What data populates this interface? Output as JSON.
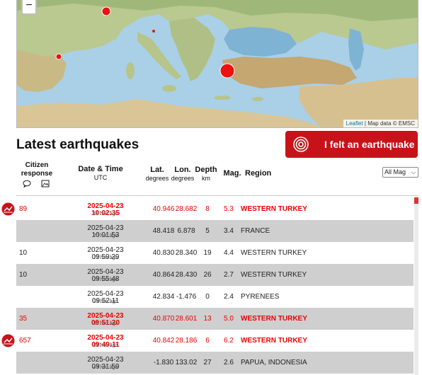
{
  "map": {
    "zoom_out": "−",
    "attribution_link": "Leaflet",
    "attribution_text": "| Map data © EMSC",
    "markers": [
      {
        "region": "WESTERN TURKEY",
        "mag": 5.3,
        "color": "#ee1111"
      },
      {
        "region": "FRANCE",
        "mag": 3.4,
        "color": "#ee1111"
      },
      {
        "region": "PYRENEES",
        "mag": 2.4,
        "color": "#ee1111"
      },
      {
        "region": "WESTERN TURKEY",
        "mag": 6.2,
        "color": "#ee1111"
      }
    ]
  },
  "page_title": "Latest earthquakes",
  "felt_button": "I felt an earthquake",
  "table": {
    "headers": {
      "citizen": "Citizen response",
      "datetime": "Date & Time",
      "datetime_sub": "UTC",
      "lat": "Lat.",
      "lat_unit": "degrees",
      "lon": "Lon.",
      "lon_unit": "degrees",
      "depth": "Depth",
      "depth_unit": "km",
      "mag": "Mag.",
      "region": "Region"
    },
    "filter": "All Mag",
    "rows": [
      {
        "citizen": "89",
        "datetime": "2025-04-23 10:02:35",
        "ago": "19 min ago",
        "lat": "40.946",
        "lon": "28.682",
        "depth": "8",
        "mag": "5.3",
        "region": "WESTERN TURKEY",
        "highlight": true,
        "alt": false,
        "felt_icon": true
      },
      {
        "citizen": "",
        "datetime": "2025-04-23 10:01:53",
        "ago": "20 min ago",
        "lat": "48.418",
        "lon": "6.878",
        "depth": "5",
        "mag": "3.4",
        "region": "FRANCE",
        "highlight": false,
        "alt": true,
        "felt_icon": false
      },
      {
        "citizen": "10",
        "datetime": "2025-04-23 09:59:29",
        "ago": "22 min ago",
        "lat": "40.830",
        "lon": "28.340",
        "depth": "19",
        "mag": "4.4",
        "region": "WESTERN TURKEY",
        "highlight": false,
        "alt": false,
        "felt_icon": false
      },
      {
        "citizen": "10",
        "datetime": "2025-04-23 09:55:48",
        "ago": "26 min ago",
        "lat": "40.864",
        "lon": "28.430",
        "depth": "26",
        "mag": "2.7",
        "region": "WESTERN TURKEY",
        "highlight": false,
        "alt": true,
        "felt_icon": false
      },
      {
        "citizen": "",
        "datetime": "2025-04-23 09:52:11",
        "ago": "29 min ago",
        "lat": "42.834",
        "lon": "-1.476",
        "depth": "0",
        "mag": "2.4",
        "region": "PYRENEES",
        "highlight": false,
        "alt": false,
        "felt_icon": false
      },
      {
        "citizen": "35",
        "datetime": "2025-04-23 09:51:20",
        "ago": "30 min ago",
        "lat": "40.870",
        "lon": "28.601",
        "depth": "13",
        "mag": "5.0",
        "region": "WESTERN TURKEY",
        "highlight": true,
        "alt": true,
        "felt_icon": false
      },
      {
        "citizen": "657",
        "datetime": "2025-04-23 09:49:11",
        "ago": "32 min ago",
        "lat": "40.842",
        "lon": "28.186",
        "depth": "6",
        "mag": "6.2",
        "region": "WESTERN TURKEY",
        "highlight": true,
        "alt": false,
        "felt_icon": true
      },
      {
        "citizen": "",
        "datetime": "2025-04-23 09:31:59",
        "ago": "49 min ago",
        "lat": "-1.830",
        "lon": "133.02",
        "depth": "27",
        "mag": "2.6",
        "region": "PAPUA, INDONESIA",
        "highlight": false,
        "alt": true,
        "felt_icon": false
      }
    ]
  },
  "colors": {
    "accent": "#c81219",
    "highlight_text": "#ee0000",
    "alt_row": "#cfcfcf"
  }
}
